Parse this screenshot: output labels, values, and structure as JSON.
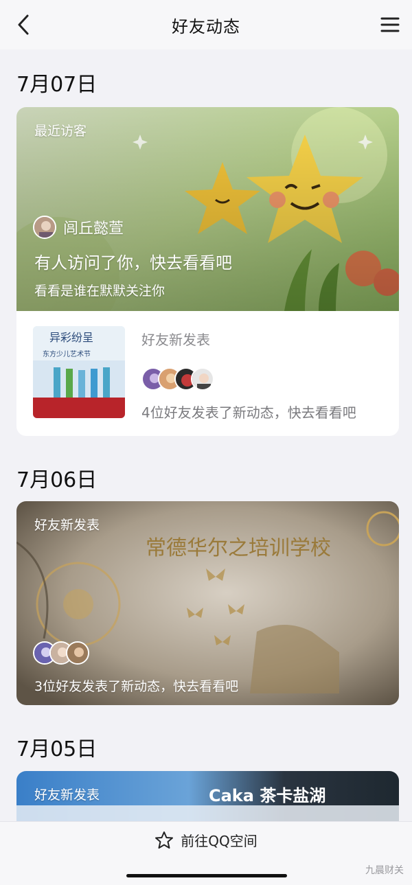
{
  "nav": {
    "title": "好友动态",
    "back_icon": "chevron-left-icon",
    "menu_icon": "hamburger-menu-icon"
  },
  "sections": [
    {
      "date": "7月07日",
      "card": {
        "tag": "最近访客",
        "visitor_name": "闾丘懿萱",
        "headline": "有人访问了你，快去看看吧",
        "subline": "看看是谁在默默关注你",
        "sub": {
          "label": "好友新发表",
          "thumb_caption_1": "异彩纷呈",
          "thumb_caption_2": "东方少儿艺术节",
          "desc": "4位好友发表了新动态，快去看看吧",
          "avatar_count": 4
        }
      }
    },
    {
      "date": "7月06日",
      "card": {
        "tag": "好友新发表",
        "photo_text": "常德华尔之培训学校",
        "desc": "3位好友发表了新动态，快去看看吧",
        "avatar_count": 3
      }
    },
    {
      "date": "7月05日",
      "card": {
        "tag": "好友新发表",
        "photo_text": "Caka 茶卡盐湖"
      }
    }
  ],
  "bottom": {
    "link_label": "前往QQ空间",
    "link_icon": "star-outline-icon",
    "watermark": "九晨财关"
  },
  "colors": {
    "background": "#f2f2f6",
    "card": "#ffffff",
    "secondary_text": "#8a8a8e"
  }
}
